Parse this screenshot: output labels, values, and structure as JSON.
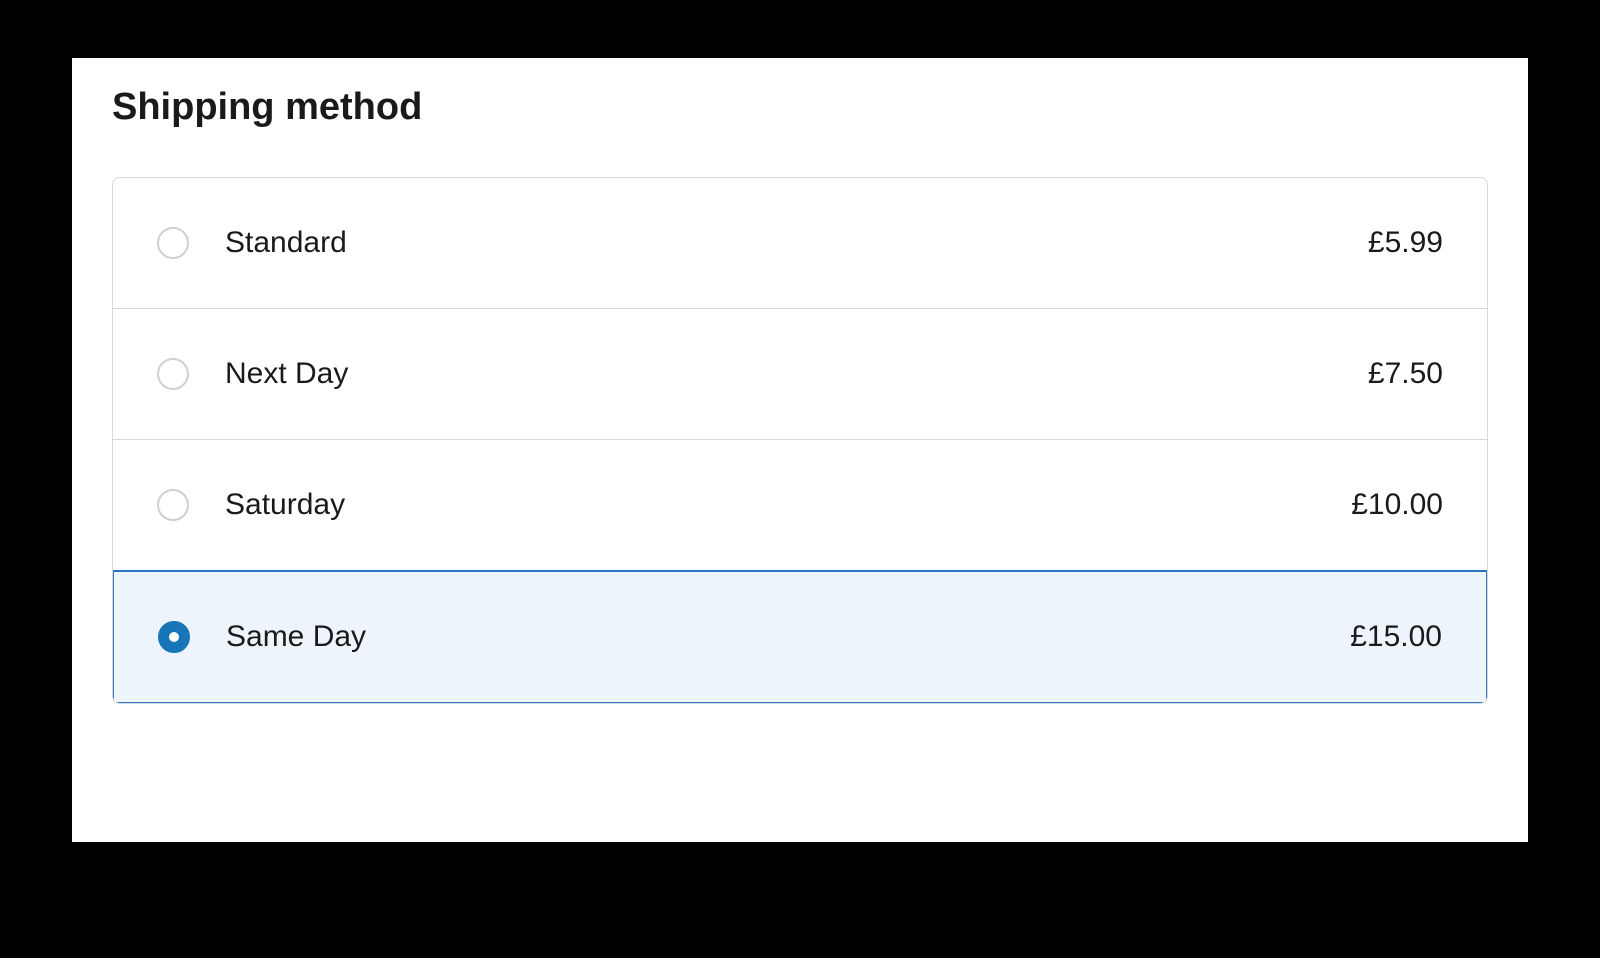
{
  "section": {
    "title": "Shipping method"
  },
  "options": [
    {
      "label": "Standard",
      "price": "£5.99",
      "selected": false
    },
    {
      "label": "Next Day",
      "price": "£7.50",
      "selected": false
    },
    {
      "label": "Saturday",
      "price": "£10.00",
      "selected": false
    },
    {
      "label": "Same Day",
      "price": "£15.00",
      "selected": true
    }
  ],
  "colors": {
    "accent": "#1676b8",
    "selected_bg": "#eef4fb",
    "selected_border": "#2d77c2",
    "border": "#d9d9d9"
  }
}
